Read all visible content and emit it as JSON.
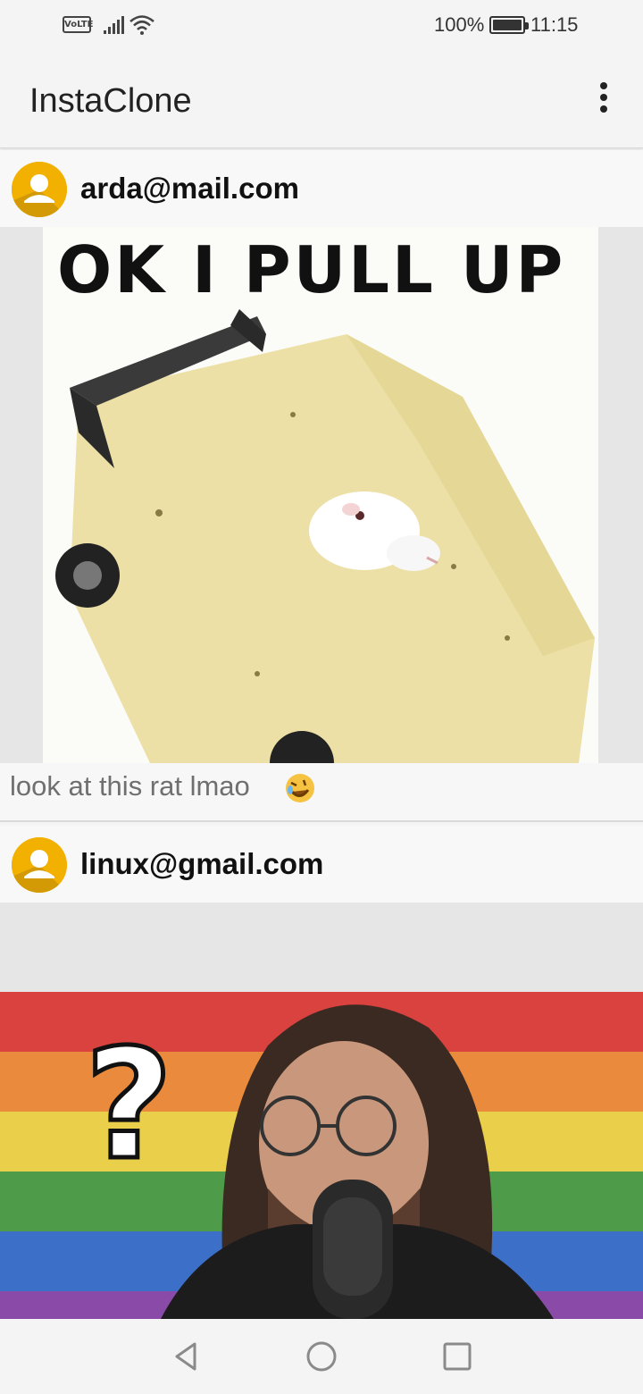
{
  "status_bar": {
    "network_badge": "VoLTE",
    "battery_percent": "100%",
    "time": "11:15",
    "icons": [
      "volte-icon",
      "signal-icon",
      "wifi-icon",
      "battery-icon"
    ]
  },
  "app_bar": {
    "title": "InstaClone",
    "menu_icon": "more-vert-icon"
  },
  "posts": [
    {
      "author": "arda@mail.com",
      "image_text": "OK I PULL UP",
      "caption": "look at this rat lmao",
      "caption_emoji": "rolling-on-floor-laughing-icon"
    },
    {
      "author": "linux@gmail.com"
    }
  ],
  "nav_bar": {
    "buttons": [
      "back-icon",
      "home-icon",
      "recents-icon"
    ]
  },
  "colors": {
    "background": "#f4f4f4",
    "avatar": "#f2b100",
    "caption_text": "#6f6f6f"
  }
}
